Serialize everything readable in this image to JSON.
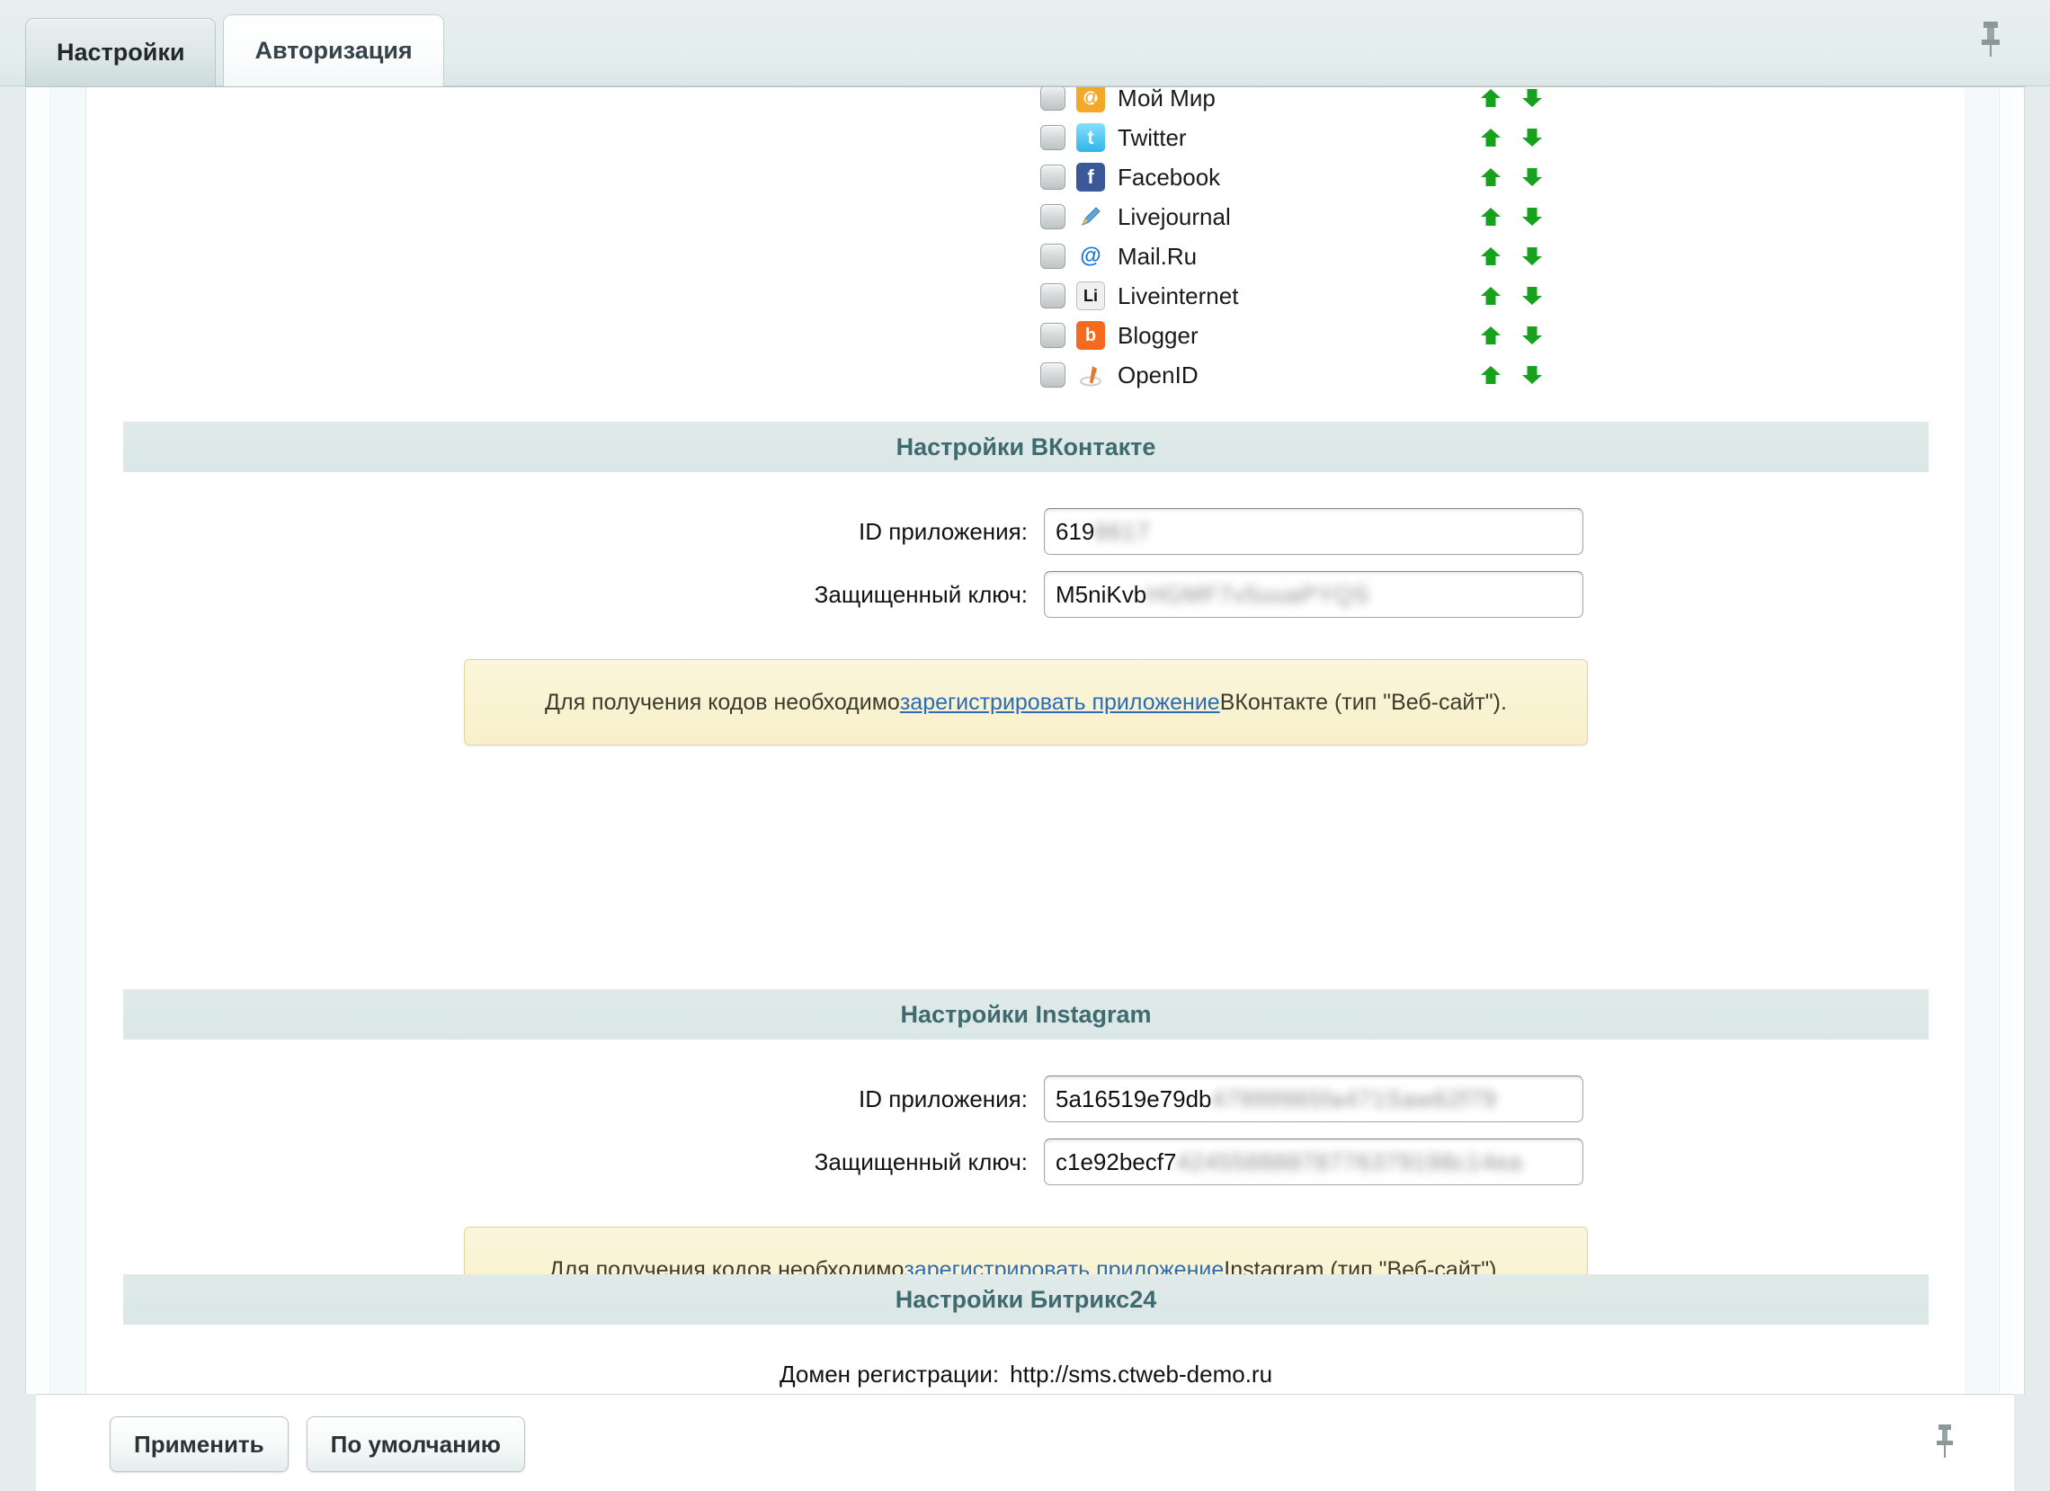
{
  "tabs": [
    {
      "label": "Настройки",
      "active": false
    },
    {
      "label": "Авторизация",
      "active": true
    }
  ],
  "icons": {
    "pin_top": "pin-icon",
    "pin_bottom": "pin-icon"
  },
  "social_networks": {
    "items": [
      {
        "label": "Мой Мир",
        "icon": "mail-ru-mymir-icon",
        "checked": false
      },
      {
        "label": "Twitter",
        "icon": "twitter-icon",
        "checked": false
      },
      {
        "label": "Facebook",
        "icon": "facebook-icon",
        "checked": false
      },
      {
        "label": "Livejournal",
        "icon": "livejournal-icon",
        "checked": false
      },
      {
        "label": "Mail.Ru",
        "icon": "mail-ru-icon",
        "checked": false
      },
      {
        "label": "Liveinternet",
        "icon": "liveinternet-icon",
        "checked": false
      },
      {
        "label": "Blogger",
        "icon": "blogger-icon",
        "checked": false
      },
      {
        "label": "OpenID",
        "icon": "openid-icon",
        "checked": false
      }
    ],
    "move_up_icon": "arrow-up-icon",
    "move_down_icon": "arrow-down-icon"
  },
  "sections": {
    "vk": {
      "title": "Настройки ВКонтакте",
      "app_id_label": "ID приложения:",
      "app_id_value": "619",
      "app_id_masked": "8617",
      "secret_label": "Защищенный ключ:",
      "secret_value": "M5niKvb",
      "secret_masked": "HGMF7v5uuaPYQS",
      "note_prefix": "Для получения кодов необходимо ",
      "note_link": "зарегистрировать приложение",
      "note_suffix": " ВКонтакте (тип \"Веб-сайт\")."
    },
    "instagram": {
      "title": "Настройки Instagram",
      "app_id_label": "ID приложения:",
      "app_id_value": "5a16519e79db",
      "app_id_masked": "47999965fa471Saw62f79",
      "secret_label": "Защищенный ключ:",
      "secret_value": "c1e92becf7",
      "secret_masked": "42455888878776379198c14ea",
      "note_prefix": "Для получения кодов необходимо ",
      "note_link": "зарегистрировать приложение",
      "note_suffix": " Instagram (тип \"Веб-сайт\")."
    },
    "bitrix24": {
      "title": "Настройки Битрикс24",
      "domain_label": "Домен регистрации:",
      "domain_value": "http://sms.ctweb-demo.ru"
    }
  },
  "footer": {
    "apply_label": "Применить",
    "default_label": "По умолчанию"
  },
  "colors": {
    "section_header_bg": "#dde8e7",
    "section_header_text": "#3f6a70",
    "note_bg": "#f9f2cd",
    "note_border": "#e0d79e",
    "link": "#2b6cb8",
    "arrow_green": "#16a21c",
    "page_bg": "#e4edec"
  }
}
